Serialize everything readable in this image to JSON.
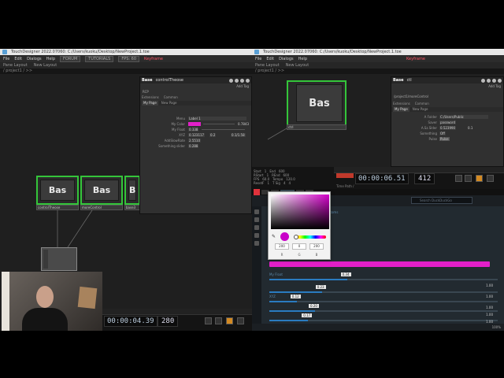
{
  "left_window": {
    "title": "TouchDesigner 2022.07060: C:/Users/kuoku/Desktop/NewProject.1.toe",
    "menu": [
      "File",
      "Edit",
      "Dialogs",
      "Help"
    ],
    "toolbar_fields": [
      "FORUM",
      "TUTORIALS",
      "FPS: 60"
    ],
    "keyframe_label": "Keyframe",
    "pane_labels": [
      "Pane Layout",
      "New Layout"
    ],
    "path": "/ project1 / >>",
    "nodes": [
      {
        "text": "Bas",
        "label": "controlTheose"
      },
      {
        "text": "Bas",
        "label": "moreControl"
      },
      {
        "text": "Bas",
        "label": "base3"
      }
    ],
    "param_panel": {
      "type_label": "Base",
      "name": "controlTheose",
      "add_tag": "Add Tag",
      "op_type": "RCP",
      "tabs_top": [
        "Extensions",
        "Common"
      ],
      "tabs_page": [
        "My Page",
        "New Page"
      ],
      "rows": [
        {
          "label": "Menu",
          "value": "Label 1"
        },
        {
          "label": "My Color",
          "value": "",
          "extra": "0.7843"
        },
        {
          "label": "My Float",
          "value": "0.338"
        },
        {
          "label": "XYZ",
          "value": "0.123117",
          "extra": "0.2",
          "extra2": "0.1/1.58"
        },
        {
          "label": "AddSlowRate",
          "value": "2.5510"
        },
        {
          "label": "Something slider",
          "value": "0.288"
        }
      ]
    },
    "timeline": {
      "timecode": "00:00:04.39",
      "frame": "280"
    }
  },
  "right_window": {
    "title": "TouchDesigner 2022.07060: C:/Users/kuoku/Desktop/NewProject.1.toe",
    "menu": [
      "File",
      "Edit",
      "Dialogs",
      "Help"
    ],
    "keyframe_label": "Keyframe",
    "pane_labels": [
      "Pane Layout",
      "New Layout"
    ],
    "path": "/ project1 / >>",
    "node": {
      "text": "Bas",
      "label": "ctrl"
    },
    "param_panel": {
      "type_label": "Base",
      "name": "ctl",
      "add_tag": "Add Tag",
      "path_line": "/project1/moreControl",
      "tabs_top": [
        "Extensions",
        "Common"
      ],
      "tabs_page": [
        "My Page",
        "New Page"
      ],
      "rows": [
        {
          "label": "A Folder",
          "value": "C:/Users/Public"
        },
        {
          "label": "Saver",
          "value": "password"
        },
        {
          "label": "A.Sz.Slder",
          "value": "0.523990",
          "extra": "0.1"
        },
        {
          "label": "Something",
          "value": "Off"
        },
        {
          "label": "Pulse",
          "value": "Pulse"
        }
      ]
    },
    "timeline": {
      "info": [
        [
          "Start",
          "1",
          "End",
          "600"
        ],
        [
          "RStart",
          "1",
          "REnd",
          "600"
        ],
        [
          "FPS",
          "60.0",
          "Tempo",
          "120.0"
        ],
        [
          "ResetF",
          "1",
          "T Sig",
          "4",
          "4"
        ]
      ],
      "timecode": "00:00:06.51",
      "frame": "412",
      "time_path": "Time Path /"
    }
  },
  "browser": {
    "search_placeholder": "Search DuckDuckGo",
    "tab_label": "Customs",
    "zoom": "100%",
    "sliders": [
      {
        "label": "My Float",
        "value": "0.34",
        "fraction": 0.34,
        "end": "1.00"
      },
      {
        "label": "",
        "value": "0.23",
        "fraction": 0.23,
        "end": "1.00"
      },
      {
        "label": "XYZ",
        "value": "0.12",
        "fraction": 0.12,
        "end": "1.00"
      },
      {
        "label": "",
        "value": "0.20",
        "fraction": 0.2,
        "end": "1.00"
      },
      {
        "label": "",
        "value": "0.17",
        "fraction": 0.17,
        "end": "1.00"
      }
    ]
  },
  "color_picker": {
    "r": "200",
    "g": "0",
    "b": "200",
    "channels": [
      "R",
      "G",
      "B"
    ],
    "color": "#c800c8"
  },
  "colors": {
    "node_border": "#34c53a",
    "swatch": "#e21fc8",
    "accent": "#2a7bc0",
    "play": "#d48a22"
  }
}
